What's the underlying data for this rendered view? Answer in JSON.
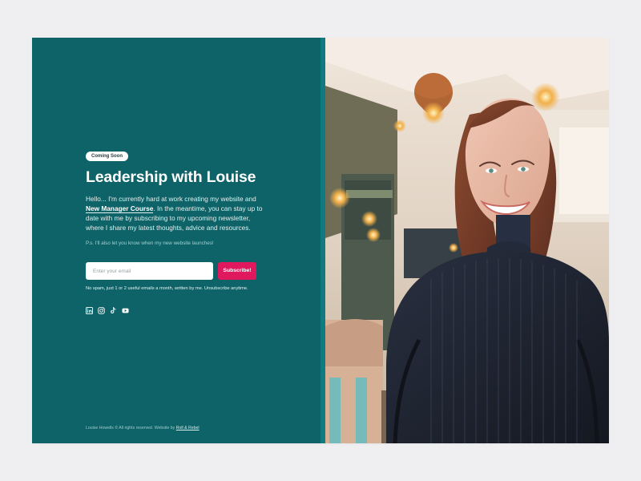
{
  "page": {
    "badge": "Coming Soon",
    "title": "Leadership with Louise",
    "intro": {
      "before": "Hello... I'm currently hard at work creating my website and",
      "link": "New Manager Course",
      "after": ". In the meantime, you can stay up to date with me by subscribing to my upcoming newsletter, where I share my latest thoughts, advice and resources."
    },
    "ps": "P.s. I'll also let you know when my new website launches!",
    "form": {
      "email_placeholder": "Enter your email",
      "subscribe_label": "Subscribe!",
      "note": "No spam, just 1 or 2 useful emails a month, written by me. Unsubscribe anytime."
    },
    "social": [
      "linkedin-icon",
      "instagram-icon",
      "tiktok-icon",
      "youtube-icon"
    ],
    "footer": {
      "text": "Louise Howells © All rights reserved. Website by",
      "link": "Roll & Rebel"
    }
  },
  "colors": {
    "left_panel": "#0d6367",
    "accent": "#e0185e",
    "page_bg": "#efeef1"
  }
}
